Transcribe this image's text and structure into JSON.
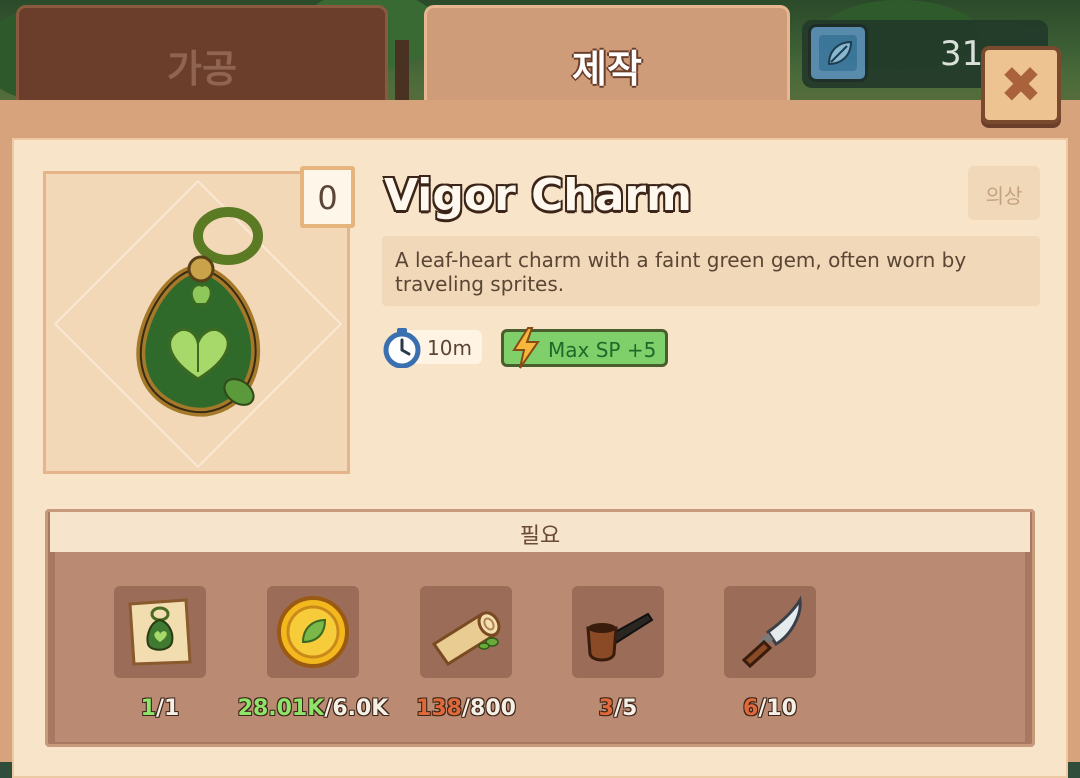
{
  "tabs": [
    {
      "label": "가공",
      "active": false
    },
    {
      "label": "제작",
      "active": true
    }
  ],
  "currency": {
    "amount": "31",
    "icon": "leaf-gem-icon"
  },
  "close": {
    "icon": "close-x-icon"
  },
  "item": {
    "name": "Vigor Charm",
    "owned_count": "0",
    "category_tag": "의상",
    "description": "A leaf-heart charm with a faint green gem, often worn by traveling sprites.",
    "craft_time": "10m",
    "bonus": "Max SP +5",
    "icon": "leaf-heart-charm-icon"
  },
  "requirements": {
    "header": "필요",
    "items": [
      {
        "icon": "charm-recipe-scroll-icon",
        "have": "1",
        "need": "/1",
        "sufficient": true
      },
      {
        "icon": "leaf-coin-icon",
        "have": "28.01K",
        "need": "/6.0K",
        "sufficient": true
      },
      {
        "icon": "wood-log-icon",
        "have": "138",
        "need": "/800",
        "sufficient": false
      },
      {
        "icon": "smoking-pipe-icon",
        "have": "3",
        "need": "/5",
        "sufficient": false
      },
      {
        "icon": "knife-icon",
        "have": "6",
        "need": "/10",
        "sufficient": false
      }
    ]
  },
  "colors": {
    "sufficient": "#8fe46a",
    "insufficient": "#e0693a",
    "panel": "#f8e4c9",
    "frame": "#d6a37d"
  }
}
